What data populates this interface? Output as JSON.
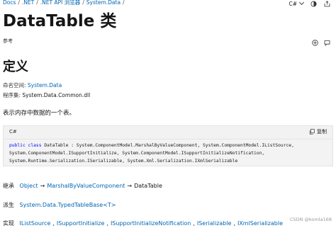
{
  "breadcrumb": [
    "Docs",
    ".NET",
    ".NET API 浏览器",
    "System.Data"
  ],
  "language": "C#",
  "page_title": "DataTable 类",
  "reference_label": "参考",
  "section_heading": "定义",
  "namespace": {
    "label": "命名空间:",
    "value": "System.Data"
  },
  "assembly": {
    "label": "程序集:",
    "value": "System.Data.Common.dll"
  },
  "description": "表示内存中数据的一个表。",
  "code": {
    "lang": "C#",
    "copy_label": "复制",
    "lines": [
      "public class DataTable : System.ComponentModel.MarshalByValueComponent, System.ComponentModel.IListSource,",
      "System.ComponentModel.ISupportInitialize, System.ComponentModel.ISupportInitializeNotification,",
      "System.Runtime.Serialization.ISerializable, System.Xml.Serialization.IXmlSerializable"
    ]
  },
  "inheritance": {
    "label": "继承",
    "items": [
      "Object",
      "MarshalByValueComponent",
      "DataTable"
    ],
    "arrow": "→"
  },
  "derived": {
    "label": "派生",
    "items": [
      "System.Data.TypedTableBase<T>"
    ]
  },
  "implements": {
    "label": "实现",
    "items": [
      "IListSource",
      "ISupportInitialize",
      "ISupportInitializeNotification",
      "ISerializable",
      "IXmlSerializable"
    ]
  },
  "watermark": "CSDN @komla168",
  "icons": [
    "chevron-down-icon",
    "theme-icon",
    "share-icon",
    "copy-icon",
    "add-collection-icon",
    "feedback-icon"
  ],
  "colors": {
    "link": "#0065b3",
    "code_bg": "#f3f3f3",
    "keyword": "#0000ff"
  }
}
